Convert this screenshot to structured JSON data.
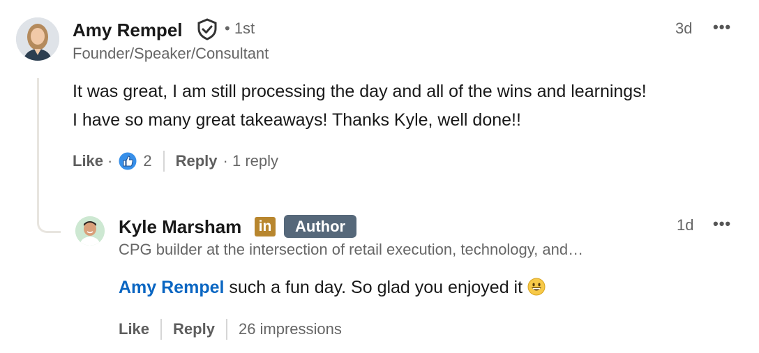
{
  "comment": {
    "author": "Amy Rempel",
    "degree": "• 1st",
    "headline": "Founder/Speaker/Consultant",
    "time": "3d",
    "more": "•••",
    "text_line1": "It was great, I am still processing the day and all of the wins and learnings!",
    "text_line2": "I have so many great takeaways! Thanks Kyle, well done!!",
    "like_label": "Like",
    "dot": "·",
    "reaction_count": "2",
    "reply_label": "Reply",
    "replies": "· 1 reply"
  },
  "reply": {
    "author": "Kyle Marsham",
    "linkedin_badge": "in",
    "author_badge": "Author",
    "headline": "CPG builder at the intersection of retail execution, technology, and…",
    "time": "1d",
    "more": "•••",
    "mention": "Amy Rempel",
    "text": " such a fun day. So glad you enjoyed it ",
    "like_label": "Like",
    "reply_label": "Reply",
    "impressions": "26 impressions"
  },
  "colors": {
    "link": "#0a66c2",
    "author_badge_bg": "#56687a",
    "linkedin_badge_bg": "#b8862e"
  }
}
